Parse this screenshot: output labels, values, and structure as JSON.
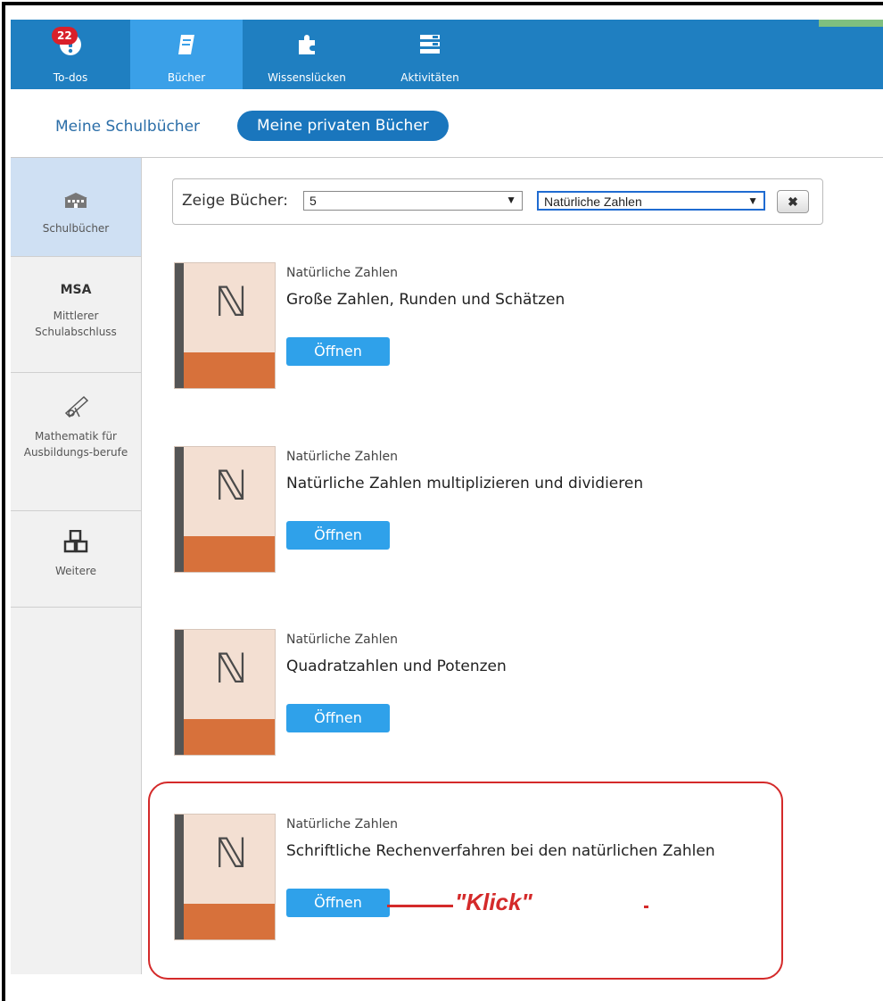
{
  "nav": {
    "items": [
      {
        "label": "To-dos",
        "icon": "alert-icon",
        "badge": "22"
      },
      {
        "label": "Bücher",
        "icon": "book-icon"
      },
      {
        "label": "Wissenslücken",
        "icon": "puzzle-icon"
      },
      {
        "label": "Aktivitäten",
        "icon": "list-icon"
      }
    ]
  },
  "subnav": {
    "link": "Meine Schulbücher",
    "active_pill": "Meine privaten Bücher"
  },
  "sidebar": {
    "items": [
      {
        "label": "Schulbücher",
        "icon": "school-icon"
      },
      {
        "abbr": "MSA",
        "label": "Mittlerer Schulabschluss"
      },
      {
        "label": "Mathematik für Ausbildungs-berufe",
        "icon": "telescope-icon"
      },
      {
        "label": "Weitere",
        "icon": "cubes-icon"
      }
    ]
  },
  "filter": {
    "label": "Zeige Bücher:",
    "grade_value": "5",
    "topic_value": "Natürliche Zahlen",
    "clear_label": "✖"
  },
  "books": [
    {
      "category": "Natürliche Zahlen",
      "title": "Große Zahlen, Runden und Schätzen",
      "button": "Öffnen"
    },
    {
      "category": "Natürliche Zahlen",
      "title": "Natürliche Zahlen multiplizieren und dividieren",
      "button": "Öffnen"
    },
    {
      "category": "Natürliche Zahlen",
      "title": "Quadratzahlen und Potenzen",
      "button": "Öffnen"
    },
    {
      "category": "Natürliche Zahlen",
      "title": "Schriftliche Rechenverfahren bei den natürlichen Zahlen",
      "button": "Öffnen"
    }
  ],
  "cover_glyph": "ℕ",
  "annotation": {
    "text": "\"Klick\"",
    "color": "#d42a2a"
  },
  "colors": {
    "topbar": "#1f7fc1",
    "active_nav": "#3aa0e8",
    "button": "#2fa1ea",
    "cover_band": "#d7713b"
  }
}
